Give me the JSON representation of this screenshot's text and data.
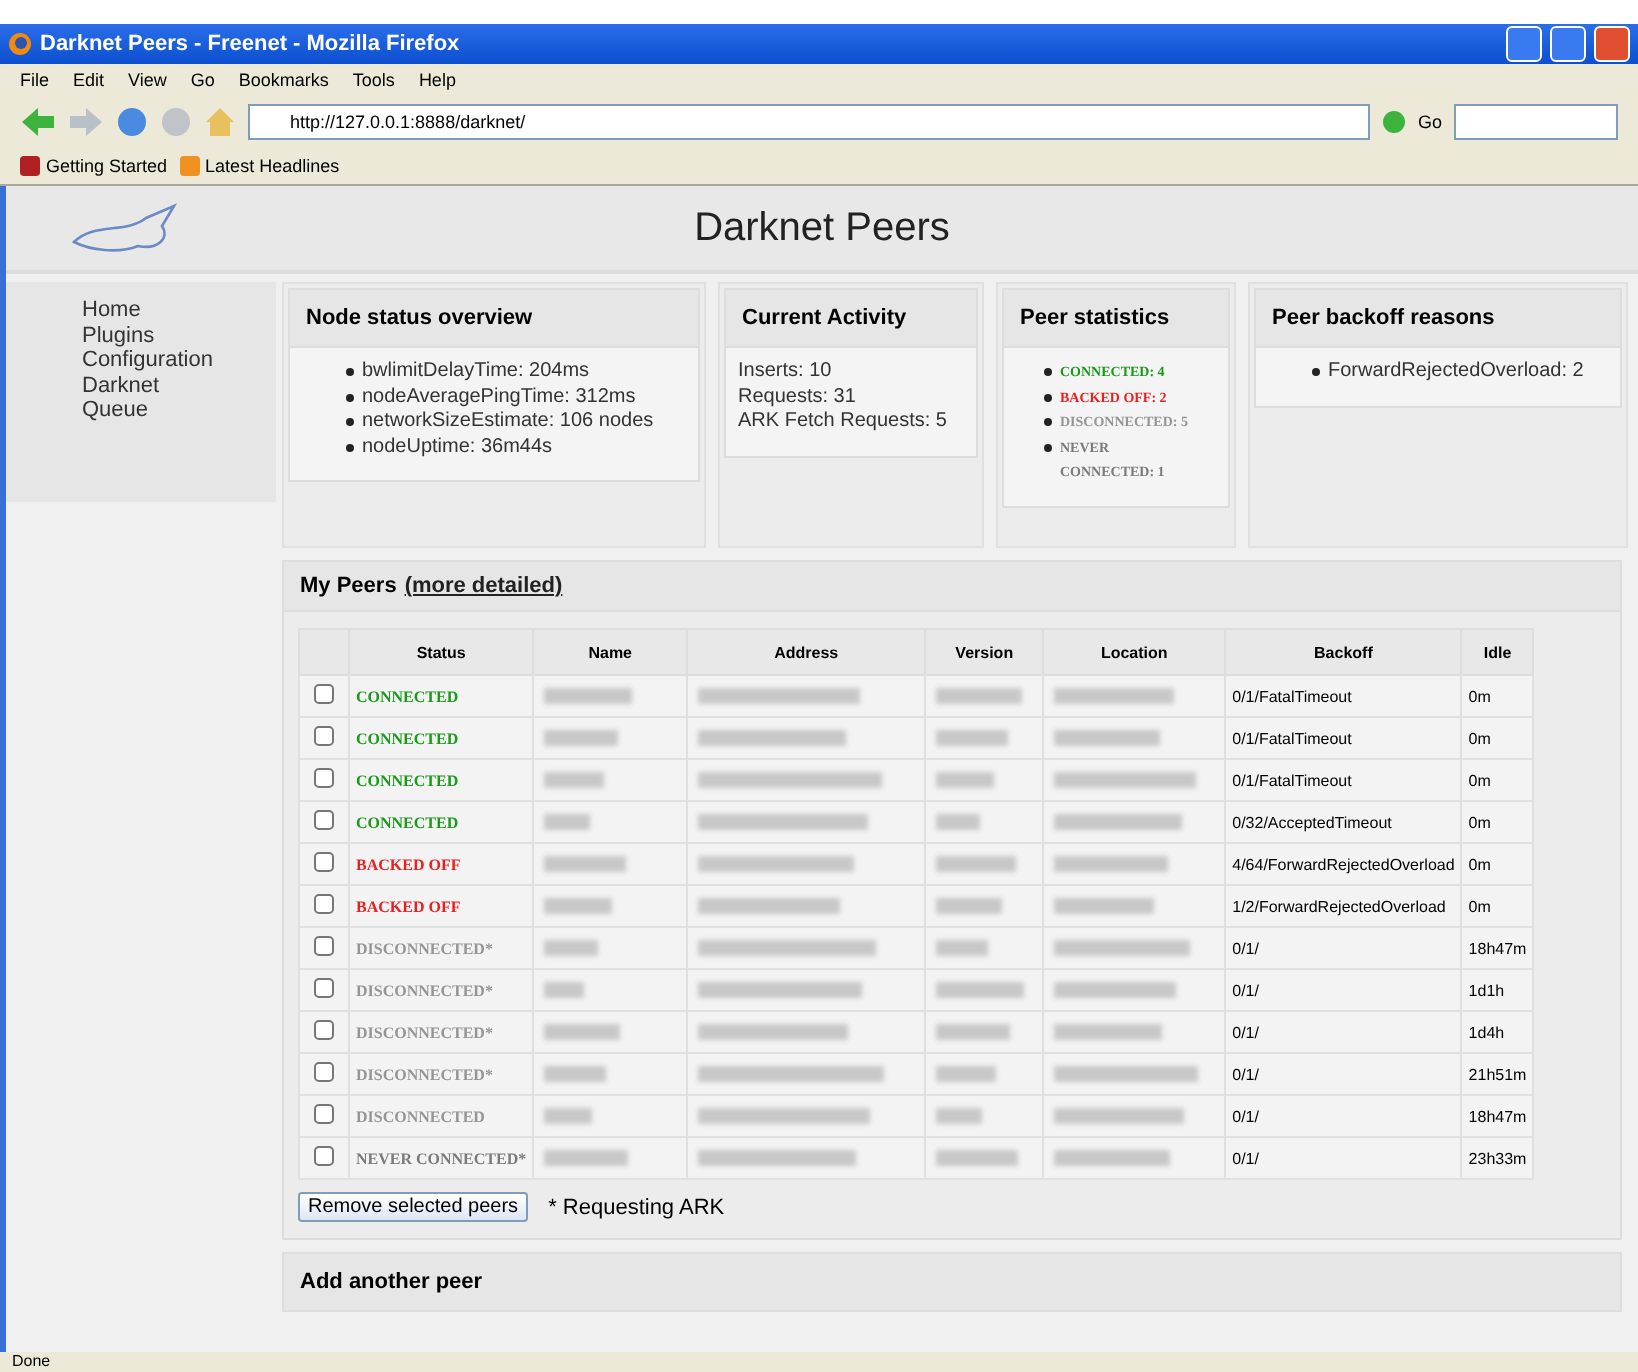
{
  "window": {
    "title": "Darknet Peers - Freenet - Mozilla Firefox"
  },
  "menu": [
    "File",
    "Edit",
    "View",
    "Go",
    "Bookmarks",
    "Tools",
    "Help"
  ],
  "address_bar": {
    "value": "http://127.0.0.1:8888/darknet/",
    "go": "Go"
  },
  "bookmarks": [
    "Getting Started",
    "Latest Headlines"
  ],
  "page": {
    "title": "Darknet Peers"
  },
  "sidebar": {
    "items": [
      "Home",
      "Plugins",
      "Configuration",
      "Darknet",
      "Queue"
    ]
  },
  "node_status": {
    "title": "Node status overview",
    "items": [
      "bwlimitDelayTime: 204ms",
      "nodeAveragePingTime: 312ms",
      "networkSizeEstimate: 106 nodes",
      "nodeUptime: 36m44s"
    ]
  },
  "current_activity": {
    "title": "Current Activity",
    "lines": [
      "Inserts: 10",
      "Requests: 31",
      "ARK Fetch Requests: 5"
    ]
  },
  "peer_statistics": {
    "title": "Peer statistics",
    "items": [
      {
        "text": "CONNECTED: 4",
        "kind": "connected"
      },
      {
        "text": "BACKED OFF: 2",
        "kind": "backed_off"
      },
      {
        "text": "DISCONNECTED: 5",
        "kind": "disconnected"
      },
      {
        "text": "NEVER CONNECTED: 1",
        "kind": "never"
      }
    ]
  },
  "backoff_reasons": {
    "title": "Peer backoff reasons",
    "items": [
      "ForwardRejectedOverload: 2"
    ]
  },
  "my_peers": {
    "title": "My Peers",
    "link": "(more detailed)",
    "columns": [
      "Status",
      "Name",
      "Address",
      "Version",
      "Location",
      "Backoff",
      "Idle"
    ],
    "rows": [
      {
        "checked": false,
        "kind": "connected",
        "status": "CONNECTED",
        "backoff": "0/1/FatalTimeout",
        "idle": "0m"
      },
      {
        "checked": false,
        "kind": "connected",
        "status": "CONNECTED",
        "backoff": "0/1/FatalTimeout",
        "idle": "0m"
      },
      {
        "checked": false,
        "kind": "connected",
        "status": "CONNECTED",
        "backoff": "0/1/FatalTimeout",
        "idle": "0m"
      },
      {
        "checked": false,
        "kind": "connected",
        "status": "CONNECTED",
        "backoff": "0/32/AcceptedTimeout",
        "idle": "0m"
      },
      {
        "checked": false,
        "kind": "backed_off",
        "status": "BACKED OFF",
        "backoff": "4/64/ForwardRejectedOverload",
        "idle": "0m"
      },
      {
        "checked": false,
        "kind": "backed_off",
        "status": "BACKED OFF",
        "backoff": "1/2/ForwardRejectedOverload",
        "idle": "0m"
      },
      {
        "checked": false,
        "kind": "disconnected",
        "status": "DISCONNECTED*",
        "backoff": "0/1/",
        "idle": "18h47m"
      },
      {
        "checked": false,
        "kind": "disconnected",
        "status": "DISCONNECTED*",
        "backoff": "0/1/",
        "idle": "1d1h"
      },
      {
        "checked": false,
        "kind": "disconnected",
        "status": "DISCONNECTED*",
        "backoff": "0/1/",
        "idle": "1d4h"
      },
      {
        "checked": false,
        "kind": "disconnected",
        "status": "DISCONNECTED*",
        "backoff": "0/1/",
        "idle": "21h51m"
      },
      {
        "checked": false,
        "kind": "disconnected",
        "status": "DISCONNECTED",
        "backoff": "0/1/",
        "idle": "18h47m"
      },
      {
        "checked": false,
        "kind": "never",
        "status": "NEVER CONNECTED*",
        "backoff": "0/1/",
        "idle": "23h33m"
      }
    ],
    "remove_button": "Remove selected peers",
    "note": "* Requesting ARK"
  },
  "add_peer": {
    "title": "Add another peer"
  },
  "status_bar": {
    "text": "Done"
  }
}
